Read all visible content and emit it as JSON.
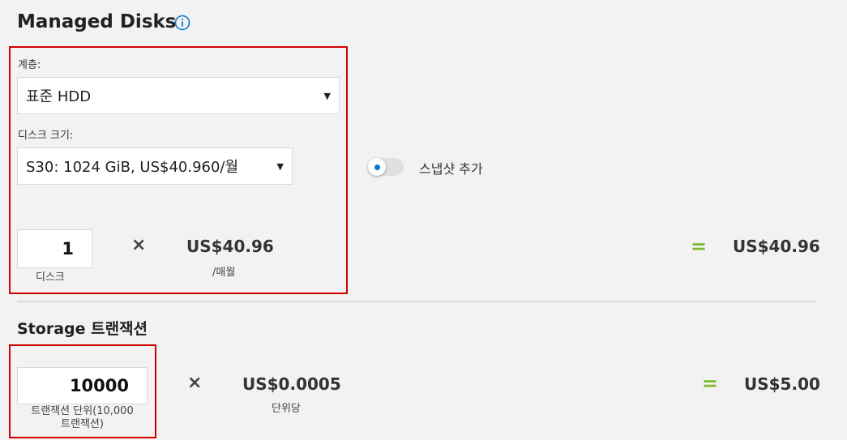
{
  "managed_disks": {
    "title": "Managed Disks",
    "tier_label": "계층:",
    "tier_value": "표준 HDD",
    "disk_size_label": "디스크 크기:",
    "disk_size_value": "S30: 1024 GiB, US$40.960/월",
    "snapshot_label": "스냅샷 추가",
    "snapshot_enabled": false,
    "quantity": "1",
    "quantity_unit": "디스크",
    "times_symbol": "×",
    "unit_price": "US$40.96",
    "unit_price_period": "/매월",
    "equals_symbol": "=",
    "total": "US$40.96"
  },
  "storage_transactions": {
    "title": "Storage 트랜잭션",
    "quantity": "10000",
    "quantity_unit_line1": "트랜잭션 단위(10,000",
    "quantity_unit_line2": "트랜잭션)",
    "times_symbol": "×",
    "unit_price": "US$0.0005",
    "unit_price_period": "단위당",
    "equals_symbol": "=",
    "total": "US$5.00"
  },
  "colors": {
    "highlight_border": "#d00000",
    "accent_blue": "#0078d4",
    "equals_green": "#7cb82f",
    "background": "#f2f2f2"
  },
  "icons": {
    "info": "info-circle-icon",
    "dropdown": "caret-down-icon"
  }
}
